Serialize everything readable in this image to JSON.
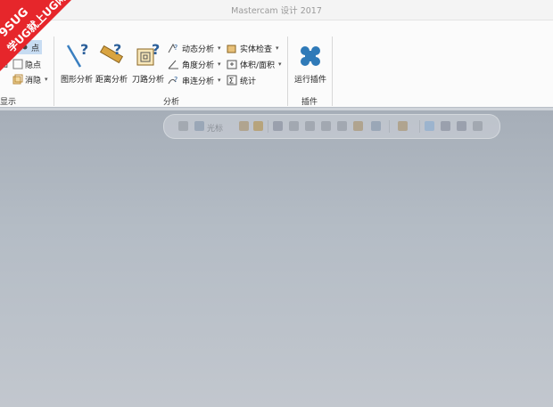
{
  "window": {
    "title": "Mastercam 设计 2017"
  },
  "watermark": {
    "line1": "9SUG",
    "line2": "学UG就上UG网"
  },
  "ribbon": {
    "display_group": {
      "label": "显示",
      "items": [
        {
          "label": "点"
        },
        {
          "label": "隐点"
        },
        {
          "label": "消隐"
        }
      ],
      "left_fragment": "图"
    },
    "analysis_group": {
      "label": "分析",
      "big_buttons": [
        {
          "label": "图形分析",
          "icon": "geometry-analysis-icon"
        },
        {
          "label": "距离分析",
          "icon": "distance-analysis-icon"
        },
        {
          "label": "刀路分析",
          "icon": "toolpath-analysis-icon"
        }
      ],
      "col1": [
        {
          "label": "动态分析"
        },
        {
          "label": "角度分析"
        },
        {
          "label": "串连分析"
        }
      ],
      "col2": [
        {
          "label": "实体检查"
        },
        {
          "label": "体积/面积"
        },
        {
          "label": "统计"
        }
      ]
    },
    "addins_group": {
      "label": "插件",
      "big_button": {
        "label": "运行插件",
        "icon": "run-addin-icon"
      }
    }
  },
  "quick_bar": {
    "cursor_label": "光标"
  },
  "colors": {
    "accent": "#2f7ab8",
    "badge": "#e6262b",
    "canvas_top": "#a6aeb8",
    "canvas_bottom": "#c2c7ce"
  }
}
